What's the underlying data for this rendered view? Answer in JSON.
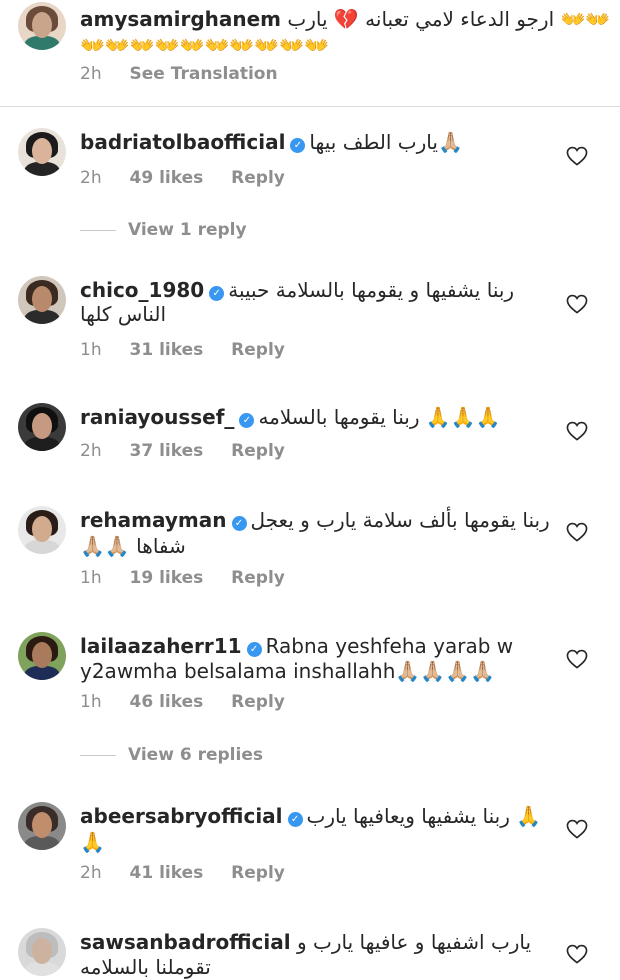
{
  "comments": [
    {
      "username": "amysamirghanem",
      "verified": false,
      "line1": "👐👐 ارجو الدعاء لامي تعبانه 💔 يارب",
      "line2": "👐👐👐👐👐👐👐👐👐👐",
      "age": "2h",
      "likes": "",
      "reply": "",
      "translate": "See Translation",
      "avatar_colors": [
        "#c9a58b",
        "#6b4b3a",
        "#2f7a6b"
      ]
    },
    {
      "username": "badriatolbaofficial",
      "verified": true,
      "line1": "🙏🏼يارب الطف بيها",
      "line2": "",
      "age": "2h",
      "likes": "49 likes",
      "reply": "Reply",
      "avatar_colors": [
        "#d9b49a",
        "#1b1b1b",
        "#242424"
      ]
    },
    {
      "username": "chico_1980",
      "verified": true,
      "line1": "ربنا يشفيها و يقومها بالسلامة حبيبة",
      "line2": "الناس كلها",
      "age": "1h",
      "likes": "31 likes",
      "reply": "Reply",
      "avatar_colors": [
        "#b88a6b",
        "#3a2a20",
        "#2b2b2b"
      ]
    },
    {
      "username": "raniayoussef_",
      "verified": true,
      "line1": "🙏🙏🙏 ربنا يقومها بالسلامه",
      "line2": "",
      "age": "2h",
      "likes": "37 likes",
      "reply": "Reply",
      "avatar_colors": [
        "#c69a80",
        "#101010",
        "#1e1e1e"
      ]
    },
    {
      "username": "rehamayman",
      "verified": true,
      "line1": "ربنا يقومها بألف سلامة يارب و يعجل",
      "line2": "🙏🏼🙏🏼 شفاها",
      "age": "1h",
      "likes": "19 likes",
      "reply": "Reply",
      "avatar_colors": [
        "#d2aa8e",
        "#2a1d17",
        "#d7d7d7"
      ]
    },
    {
      "username": "lailaazaherr11",
      "verified": true,
      "line1": "Rabna yeshfeha yarab w",
      "line2": "y2awmha belsalama inshallahh🙏🏼🙏🏼🙏🏼🙏🏼",
      "age": "1h",
      "likes": "46 likes",
      "reply": "Reply",
      "avatar_colors": [
        "#a97b5c",
        "#1d2d55",
        "#3d6a2f"
      ]
    },
    {
      "username": "abeersabryofficial",
      "verified": true,
      "line1": "🙏 ربنا يشفيها ويعافيها يارب",
      "line2": "🙏",
      "age": "2h",
      "likes": "41 likes",
      "reply": "Reply",
      "avatar_colors": [
        "#c08d6d",
        "#3a2c28",
        "#5a5a5a"
      ]
    },
    {
      "username": "sawsanbadrofficial",
      "verified": false,
      "line1": "يارب اشفيها و عافيها يارب و",
      "line2": "تقوملنا بالسلامه",
      "age": "",
      "likes": "",
      "reply": "",
      "avatar_colors": [
        "#cdb2a0",
        "#bdbdbd",
        "#e0e0e0"
      ]
    }
  ],
  "view_replies": [
    "View 1 reply",
    "View 6 replies"
  ]
}
